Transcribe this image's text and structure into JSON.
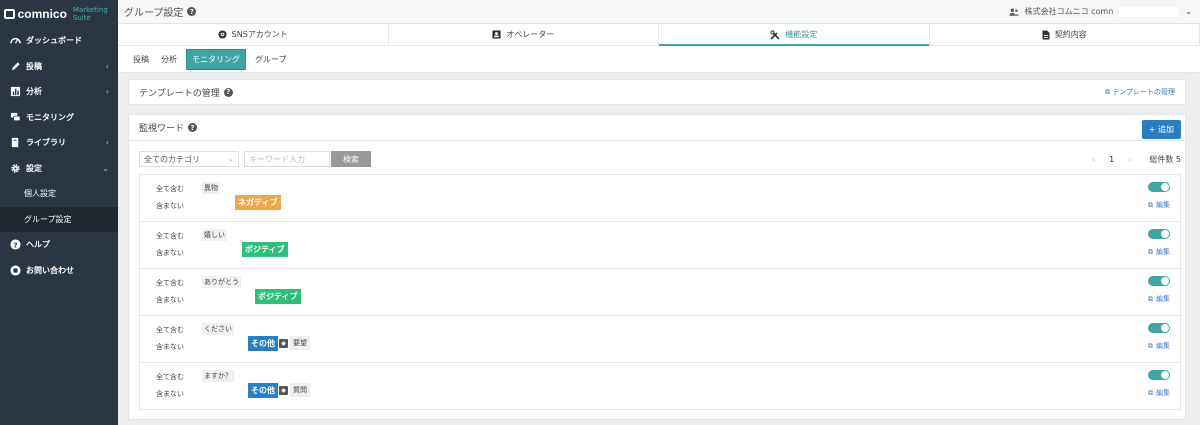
{
  "app": {
    "brand": "comnico",
    "suite": "Marketing Suite"
  },
  "sidebar": {
    "items": [
      {
        "label": "ダッシュボード",
        "icon": "dashboard-icon",
        "chev": ""
      },
      {
        "label": "投稿",
        "icon": "pencil-icon",
        "chev": "‹"
      },
      {
        "label": "分析",
        "icon": "bar-chart-icon",
        "chev": "‹"
      },
      {
        "label": "モニタリング",
        "icon": "chat-icon",
        "chev": ""
      },
      {
        "label": "ライブラリ",
        "icon": "book-icon",
        "chev": "‹"
      },
      {
        "label": "設定",
        "icon": "gear-icon",
        "chev": "⌄"
      }
    ],
    "sub": [
      {
        "label": "個人設定"
      },
      {
        "label": "グループ設定"
      }
    ],
    "bottom": [
      {
        "label": "ヘルプ",
        "icon": "help-icon"
      },
      {
        "label": "お問い合わせ",
        "icon": "contact-icon"
      }
    ]
  },
  "header": {
    "title": "グループ設定",
    "company": "株式会社コムニコ comn"
  },
  "main_tabs": [
    {
      "label": "SNSアカウント",
      "icon": "globe-icon"
    },
    {
      "label": "オペレーター",
      "icon": "id-card-icon"
    },
    {
      "label": "機能設定",
      "icon": "tools-icon"
    },
    {
      "label": "契約内容",
      "icon": "document-icon"
    }
  ],
  "sub_tabs": [
    {
      "label": "投稿"
    },
    {
      "label": "分析"
    },
    {
      "label": "モニタリング"
    },
    {
      "label": "グループ"
    }
  ],
  "template_panel": {
    "title": "テンプレートの管理",
    "link": "テンプレートの管理"
  },
  "monitor": {
    "title": "監視ワード",
    "add_label": "+ 追加",
    "category_value": "全てのカテゴリ",
    "keyword_placeholder": "キーワード入力",
    "search_label": "検索",
    "page_prev": "‹",
    "page_current": "1",
    "page_next": "›",
    "count_label": "総件数 5"
  },
  "rows": [
    {
      "include_label": "全て含む",
      "exclude_label": "含まない",
      "word": "異物",
      "sentiment": "ネガティブ",
      "sentiment_color": "#f0a74a",
      "extra_label": "",
      "edit_label": "編集"
    },
    {
      "include_label": "全て含む",
      "exclude_label": "含まない",
      "word": "嬉しい",
      "sentiment": "ポジティブ",
      "sentiment_color": "#2dbf7b",
      "extra_label": "",
      "edit_label": "編集"
    },
    {
      "include_label": "全て含む",
      "exclude_label": "含まない",
      "word": "ありがとう",
      "sentiment": "ポジティブ",
      "sentiment_color": "#2dbf7b",
      "extra_label": "",
      "edit_label": "編集"
    },
    {
      "include_label": "全て含む",
      "exclude_label": "含まない",
      "word": "ください",
      "sentiment": "その他",
      "sentiment_color": "#2a7fc1",
      "extra_label": "要望",
      "edit_label": "編集"
    },
    {
      "include_label": "全て含む",
      "exclude_label": "含まない",
      "word": "ますか？",
      "sentiment": "その他",
      "sentiment_color": "#2a7fc1",
      "extra_label": "質問",
      "edit_label": "編集"
    }
  ]
}
